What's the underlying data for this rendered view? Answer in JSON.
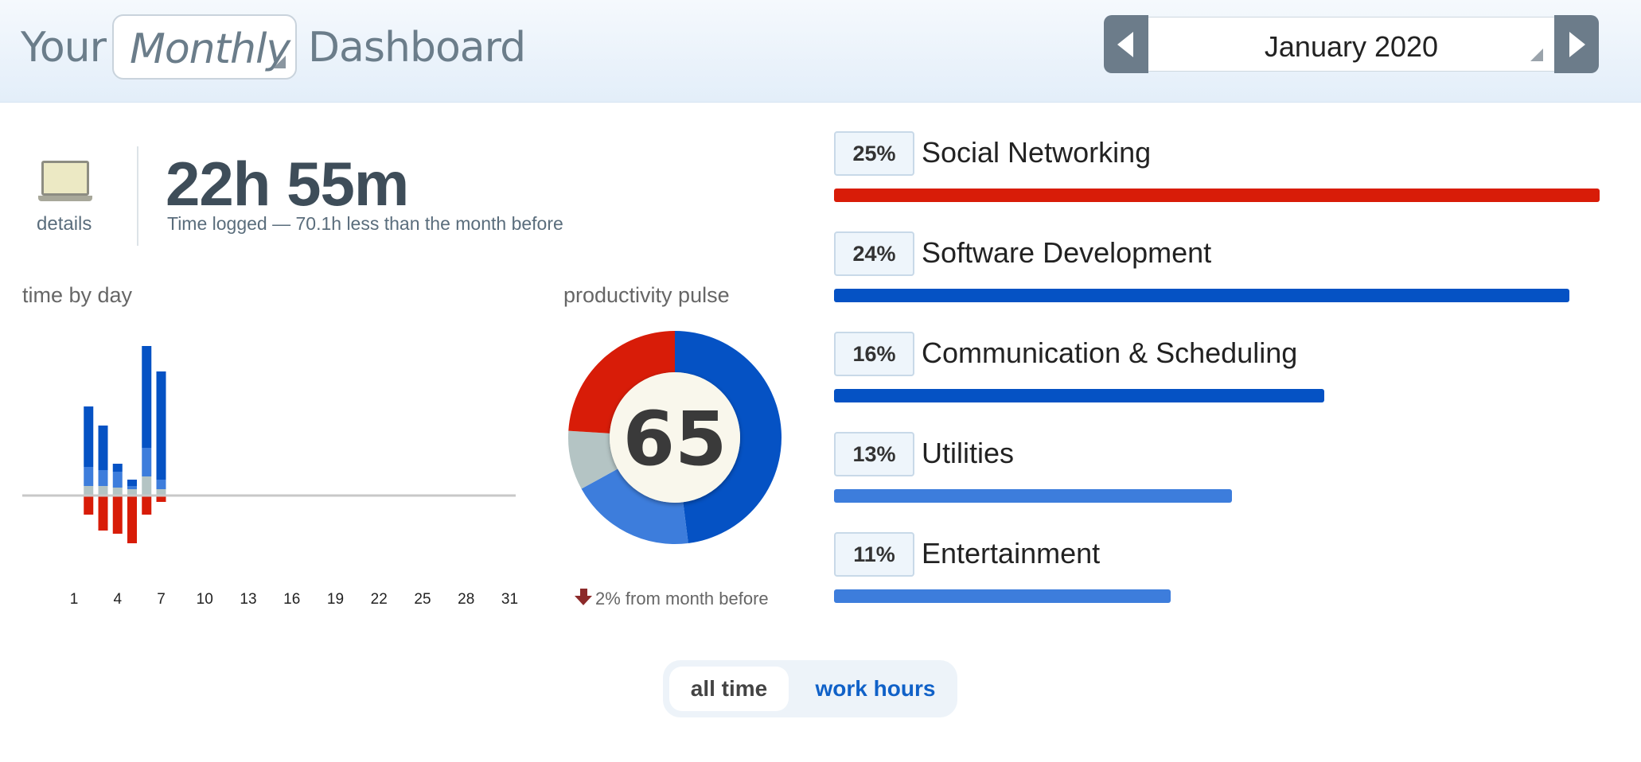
{
  "header": {
    "title_prefix": "Your",
    "period_selected": "Monthly",
    "title_suffix": "Dashboard",
    "month_selected": "January 2020"
  },
  "summary": {
    "details_label": "details",
    "total_time": "22h 55m",
    "subtitle": "Time logged — 70.1h less than the month before"
  },
  "time_by_day": {
    "title": "time by day"
  },
  "pulse": {
    "title": "productivity pulse",
    "score": "65",
    "change_text": "2% from month before"
  },
  "colors": {
    "very_productive": "#0552c4",
    "productive": "#3d7ddc",
    "neutral": "#b4c4c4",
    "distracting": "#d81c08",
    "pulse_center": "#f9f7ec"
  },
  "chart_data": [
    {
      "type": "bar",
      "title": "time by day",
      "stacked": true,
      "diverging": true,
      "x_ticks": [
        "1",
        "4",
        "7",
        "10",
        "13",
        "16",
        "19",
        "22",
        "25",
        "28",
        "31"
      ],
      "days": [
        1,
        2,
        3,
        4,
        5,
        6,
        7,
        8,
        9,
        10,
        11,
        12,
        13,
        14,
        15,
        16,
        17,
        18,
        19,
        20,
        21,
        22,
        23,
        24,
        25,
        26,
        27,
        28,
        29,
        30,
        31
      ],
      "series": [
        {
          "key": "neutral",
          "direction": "up",
          "values": [
            0,
            0.3,
            0.3,
            0.25,
            0.2,
            0.6,
            0.2,
            0,
            0,
            0,
            0,
            0,
            0,
            0,
            0,
            0,
            0,
            0,
            0,
            0,
            0,
            0,
            0,
            0,
            0,
            0,
            0,
            0,
            0,
            0,
            0
          ]
        },
        {
          "key": "productive",
          "direction": "up",
          "values": [
            0,
            0.6,
            0.5,
            0.5,
            0.1,
            0.9,
            0.3,
            0,
            0,
            0,
            0,
            0,
            0,
            0,
            0,
            0,
            0,
            0,
            0,
            0,
            0,
            0,
            0,
            0,
            0,
            0,
            0,
            0,
            0,
            0,
            0
          ]
        },
        {
          "key": "very_productive",
          "direction": "up",
          "values": [
            0,
            1.9,
            1.4,
            0.25,
            0.2,
            3.2,
            3.4,
            0,
            0,
            0,
            0,
            0,
            0,
            0,
            0,
            0,
            0,
            0,
            0,
            0,
            0,
            0,
            0,
            0,
            0,
            0,
            0,
            0,
            0,
            0,
            0
          ]
        },
        {
          "key": "distracting",
          "direction": "down",
          "values": [
            0,
            0.6,
            1.1,
            1.2,
            1.5,
            0.6,
            0.2,
            0,
            0,
            0,
            0,
            0,
            0,
            0,
            0,
            0,
            0,
            0,
            0,
            0,
            0,
            0,
            0,
            0,
            0,
            0,
            0,
            0,
            0,
            0,
            0
          ]
        }
      ]
    },
    {
      "type": "pie",
      "donut": true,
      "title": "productivity pulse",
      "center_label": "65",
      "slices": [
        {
          "key": "very_productive",
          "value": 48
        },
        {
          "key": "productive",
          "value": 19
        },
        {
          "key": "neutral",
          "value": 9
        },
        {
          "key": "distracting",
          "value": 24
        }
      ]
    },
    {
      "type": "bar",
      "orientation": "horizontal",
      "categories": [
        "Social Networking",
        "Software Development",
        "Communication & Scheduling",
        "Utilities",
        "Entertainment"
      ],
      "values": [
        25,
        24,
        16,
        13,
        11
      ],
      "value_labels": [
        "25%",
        "24%",
        "16%",
        "13%",
        "11%"
      ],
      "bar_colors": [
        "#d81c08",
        "#0552c4",
        "#0552c4",
        "#3d7ddc",
        "#3d7ddc"
      ]
    }
  ],
  "toggle": {
    "active": "all time",
    "other": "work hours"
  }
}
